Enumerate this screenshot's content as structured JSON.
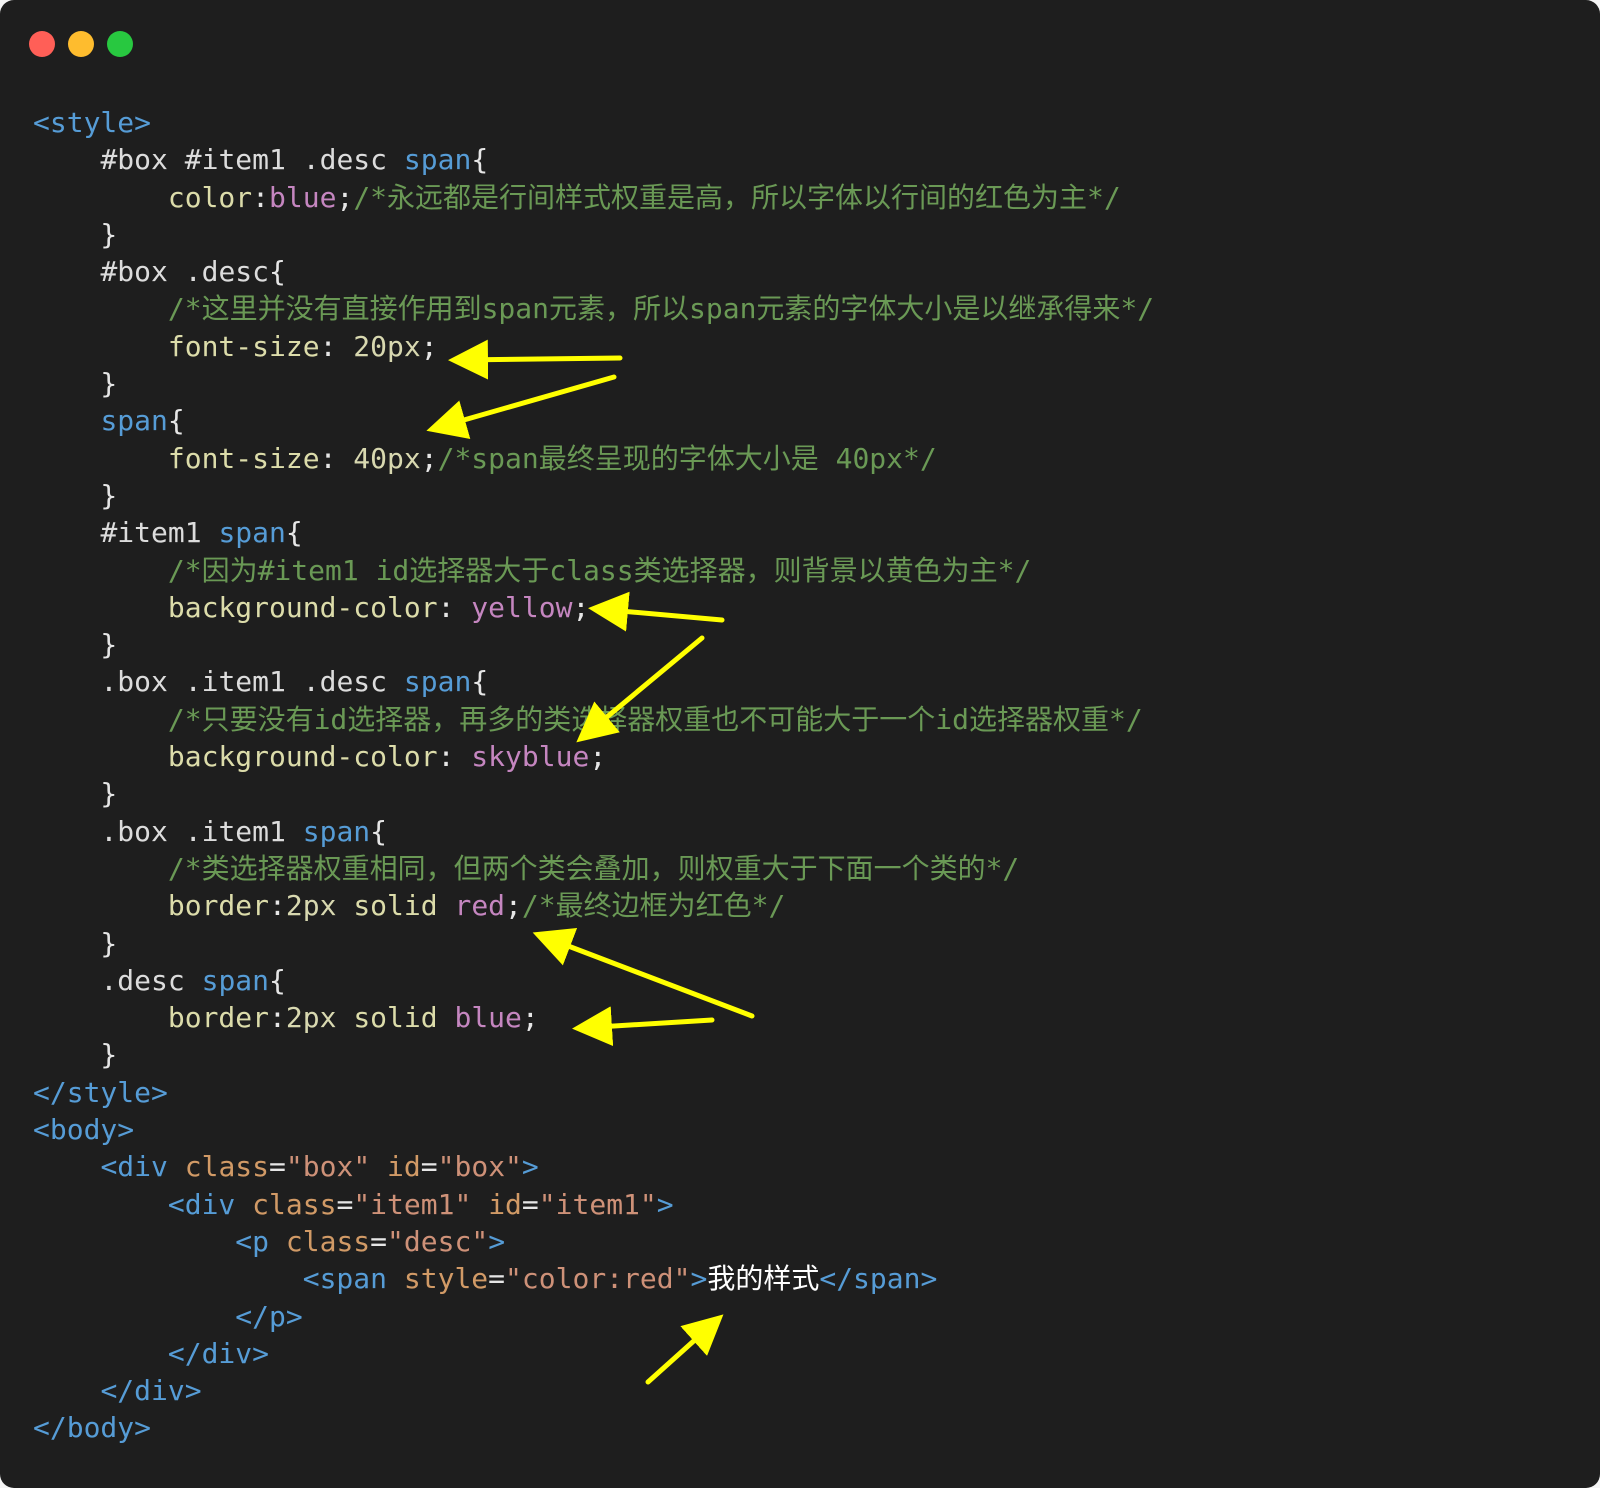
{
  "window": {
    "controls": [
      {
        "name": "close",
        "color": "#ff5f57"
      },
      {
        "name": "minimize",
        "color": "#febc2e"
      },
      {
        "name": "maximize",
        "color": "#28c840"
      }
    ]
  },
  "arrow_color": "#ffff00",
  "code_lines": [
    [
      {
        "t": "tag",
        "s": "<style>"
      }
    ],
    [
      {
        "t": "punc",
        "s": "    "
      },
      {
        "t": "sel",
        "s": "#box #item1 .desc "
      },
      {
        "t": "tag",
        "s": "span"
      },
      {
        "t": "punc",
        "s": "{"
      }
    ],
    [
      {
        "t": "punc",
        "s": "        "
      },
      {
        "t": "prop",
        "s": "color"
      },
      {
        "t": "punc",
        "s": ":"
      },
      {
        "t": "val",
        "s": "blue"
      },
      {
        "t": "punc",
        "s": ";"
      },
      {
        "t": "com",
        "s": "/*永远都是行间样式权重是高，所以字体以行间的红色为主*/"
      }
    ],
    [
      {
        "t": "punc",
        "s": "    }"
      }
    ],
    [
      {
        "t": "punc",
        "s": "    "
      },
      {
        "t": "sel",
        "s": "#box .desc"
      },
      {
        "t": "punc",
        "s": "{"
      }
    ],
    [
      {
        "t": "punc",
        "s": "        "
      },
      {
        "t": "com",
        "s": "/*这里并没有直接作用到span元素，所以span元素的字体大小是以继承得来*/"
      }
    ],
    [
      {
        "t": "punc",
        "s": "        "
      },
      {
        "t": "prop",
        "s": "font-size"
      },
      {
        "t": "punc",
        "s": ": "
      },
      {
        "t": "num",
        "s": "20px"
      },
      {
        "t": "punc",
        "s": ";"
      }
    ],
    [
      {
        "t": "punc",
        "s": "    }"
      }
    ],
    [
      {
        "t": "punc",
        "s": "    "
      },
      {
        "t": "tag",
        "s": "span"
      },
      {
        "t": "punc",
        "s": "{"
      }
    ],
    [
      {
        "t": "punc",
        "s": "        "
      },
      {
        "t": "prop",
        "s": "font-size"
      },
      {
        "t": "punc",
        "s": ": "
      },
      {
        "t": "num",
        "s": "40px"
      },
      {
        "t": "punc",
        "s": ";"
      },
      {
        "t": "com",
        "s": "/*span最终呈现的字体大小是 40px*/"
      }
    ],
    [
      {
        "t": "punc",
        "s": "    }"
      }
    ],
    [
      {
        "t": "punc",
        "s": "    "
      },
      {
        "t": "sel",
        "s": "#item1 "
      },
      {
        "t": "tag",
        "s": "span"
      },
      {
        "t": "punc",
        "s": "{"
      }
    ],
    [
      {
        "t": "punc",
        "s": "        "
      },
      {
        "t": "com",
        "s": "/*因为#item1 id选择器大于class类选择器，则背景以黄色为主*/"
      }
    ],
    [
      {
        "t": "punc",
        "s": "        "
      },
      {
        "t": "prop",
        "s": "background-color"
      },
      {
        "t": "punc",
        "s": ": "
      },
      {
        "t": "val",
        "s": "yellow"
      },
      {
        "t": "punc",
        "s": ";"
      }
    ],
    [
      {
        "t": "punc",
        "s": "    }"
      }
    ],
    [
      {
        "t": "punc",
        "s": "    "
      },
      {
        "t": "sel",
        "s": ".box .item1 .desc "
      },
      {
        "t": "tag",
        "s": "span"
      },
      {
        "t": "punc",
        "s": "{"
      }
    ],
    [
      {
        "t": "punc",
        "s": "        "
      },
      {
        "t": "com",
        "s": "/*只要没有id选择器，再多的类选择器权重也不可能大于一个id选择器权重*/"
      }
    ],
    [
      {
        "t": "punc",
        "s": "        "
      },
      {
        "t": "prop",
        "s": "background-color"
      },
      {
        "t": "punc",
        "s": ": "
      },
      {
        "t": "val",
        "s": "skyblue"
      },
      {
        "t": "punc",
        "s": ";"
      }
    ],
    [
      {
        "t": "punc",
        "s": "    }"
      }
    ],
    [
      {
        "t": "punc",
        "s": "    "
      },
      {
        "t": "sel",
        "s": ".box .item1 "
      },
      {
        "t": "tag",
        "s": "span"
      },
      {
        "t": "punc",
        "s": "{"
      }
    ],
    [
      {
        "t": "punc",
        "s": "        "
      },
      {
        "t": "com",
        "s": "/*类选择器权重相同，但两个类会叠加，则权重大于下面一个类的*/"
      }
    ],
    [
      {
        "t": "punc",
        "s": "        "
      },
      {
        "t": "prop",
        "s": "border"
      },
      {
        "t": "punc",
        "s": ":"
      },
      {
        "t": "num",
        "s": "2px"
      },
      {
        "t": "punc",
        "s": " "
      },
      {
        "t": "prop",
        "s": "solid"
      },
      {
        "t": "punc",
        "s": " "
      },
      {
        "t": "val",
        "s": "red"
      },
      {
        "t": "punc",
        "s": ";"
      },
      {
        "t": "com",
        "s": "/*最终边框为红色*/"
      }
    ],
    [
      {
        "t": "punc",
        "s": "    }"
      }
    ],
    [
      {
        "t": "punc",
        "s": "    "
      },
      {
        "t": "sel",
        "s": ".desc "
      },
      {
        "t": "tag",
        "s": "span"
      },
      {
        "t": "punc",
        "s": "{"
      }
    ],
    [
      {
        "t": "punc",
        "s": "        "
      },
      {
        "t": "prop",
        "s": "border"
      },
      {
        "t": "punc",
        "s": ":"
      },
      {
        "t": "num",
        "s": "2px"
      },
      {
        "t": "punc",
        "s": " "
      },
      {
        "t": "prop",
        "s": "solid"
      },
      {
        "t": "punc",
        "s": " "
      },
      {
        "t": "val",
        "s": "blue"
      },
      {
        "t": "punc",
        "s": ";"
      }
    ],
    [
      {
        "t": "punc",
        "s": "    }"
      }
    ],
    [
      {
        "t": "tag",
        "s": "</style>"
      }
    ],
    [
      {
        "t": "tag",
        "s": "<body>"
      }
    ],
    [
      {
        "t": "punc",
        "s": "    "
      },
      {
        "t": "tag",
        "s": "<div "
      },
      {
        "t": "attr",
        "s": "class"
      },
      {
        "t": "punc",
        "s": "="
      },
      {
        "t": "str",
        "s": "\"box\""
      },
      {
        "t": "punc",
        "s": " "
      },
      {
        "t": "attr",
        "s": "id"
      },
      {
        "t": "punc",
        "s": "="
      },
      {
        "t": "str",
        "s": "\"box\""
      },
      {
        "t": "tag",
        "s": ">"
      }
    ],
    [
      {
        "t": "punc",
        "s": "        "
      },
      {
        "t": "tag",
        "s": "<div "
      },
      {
        "t": "attr",
        "s": "class"
      },
      {
        "t": "punc",
        "s": "="
      },
      {
        "t": "str",
        "s": "\"item1\""
      },
      {
        "t": "punc",
        "s": " "
      },
      {
        "t": "attr",
        "s": "id"
      },
      {
        "t": "punc",
        "s": "="
      },
      {
        "t": "str",
        "s": "\"item1\""
      },
      {
        "t": "tag",
        "s": ">"
      }
    ],
    [
      {
        "t": "punc",
        "s": "            "
      },
      {
        "t": "tag",
        "s": "<p "
      },
      {
        "t": "attr",
        "s": "class"
      },
      {
        "t": "punc",
        "s": "="
      },
      {
        "t": "str",
        "s": "\"desc\""
      },
      {
        "t": "tag",
        "s": ">"
      }
    ],
    [
      {
        "t": "punc",
        "s": "                "
      },
      {
        "t": "tag",
        "s": "<span "
      },
      {
        "t": "attr",
        "s": "style"
      },
      {
        "t": "punc",
        "s": "="
      },
      {
        "t": "str",
        "s": "\"color:red\""
      },
      {
        "t": "tag",
        "s": ">"
      },
      {
        "t": "text",
        "s": "我的样式"
      },
      {
        "t": "tag",
        "s": "</span>"
      }
    ],
    [
      {
        "t": "punc",
        "s": "            "
      },
      {
        "t": "tag",
        "s": "</p>"
      }
    ],
    [
      {
        "t": "punc",
        "s": "        "
      },
      {
        "t": "tag",
        "s": "</div>"
      }
    ],
    [
      {
        "t": "punc",
        "s": "    "
      },
      {
        "t": "tag",
        "s": "</div>"
      }
    ],
    [
      {
        "t": "tag",
        "s": "</body>"
      }
    ]
  ]
}
